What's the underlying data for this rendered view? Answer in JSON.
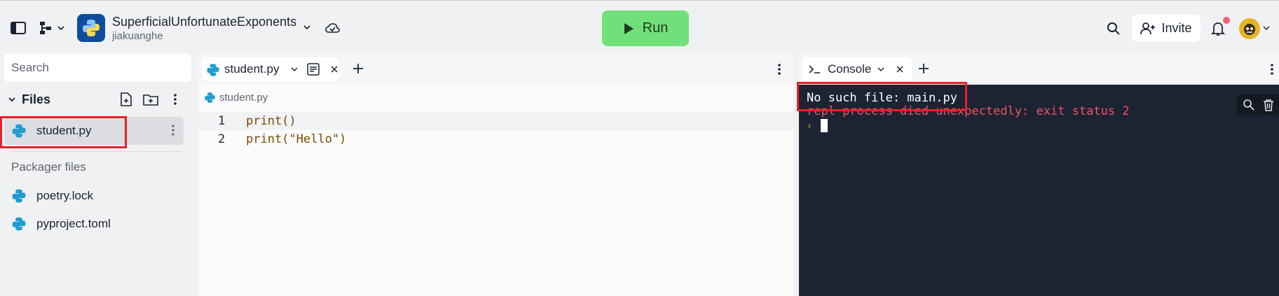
{
  "header": {
    "repl_name": "SuperficialUnfortunateExponents",
    "repl_owner": "jiakuanghe",
    "run_label": "Run",
    "invite_label": "Invite"
  },
  "sidebar": {
    "search_placeholder": "Search",
    "files_label": "Files",
    "active_file": "student.py",
    "packager_label": "Packager files",
    "packager_files": [
      "poetry.lock",
      "pyproject.toml"
    ]
  },
  "editor": {
    "tab_label": "student.py",
    "breadcrumb": "student.py",
    "lines": [
      {
        "no": "1",
        "code": "print()"
      },
      {
        "no": "2",
        "code": "print(\"Hello\")"
      }
    ]
  },
  "console": {
    "tab_label": "Console",
    "output_line": "No such file: main.py",
    "error_line": "repl process died unexpectedly: exit status 2",
    "prompt_symbol": "›"
  },
  "colors": {
    "run_button": "#72e07a",
    "console_bg": "#1c2333",
    "error_text": "#f0525e",
    "highlight": "#e8202a",
    "notification_dot": "#f2606e"
  },
  "icons": [
    "sidebar-toggle-icon",
    "file-tree-icon",
    "python-icon",
    "chevron-down-icon",
    "cloud-check-icon",
    "play-icon",
    "search-icon",
    "add-user-icon",
    "bell-icon",
    "avatar-icon",
    "new-file-icon",
    "new-folder-icon",
    "more-vertical-icon",
    "close-icon",
    "plus-icon",
    "document-icon",
    "terminal-icon",
    "trash-icon"
  ]
}
